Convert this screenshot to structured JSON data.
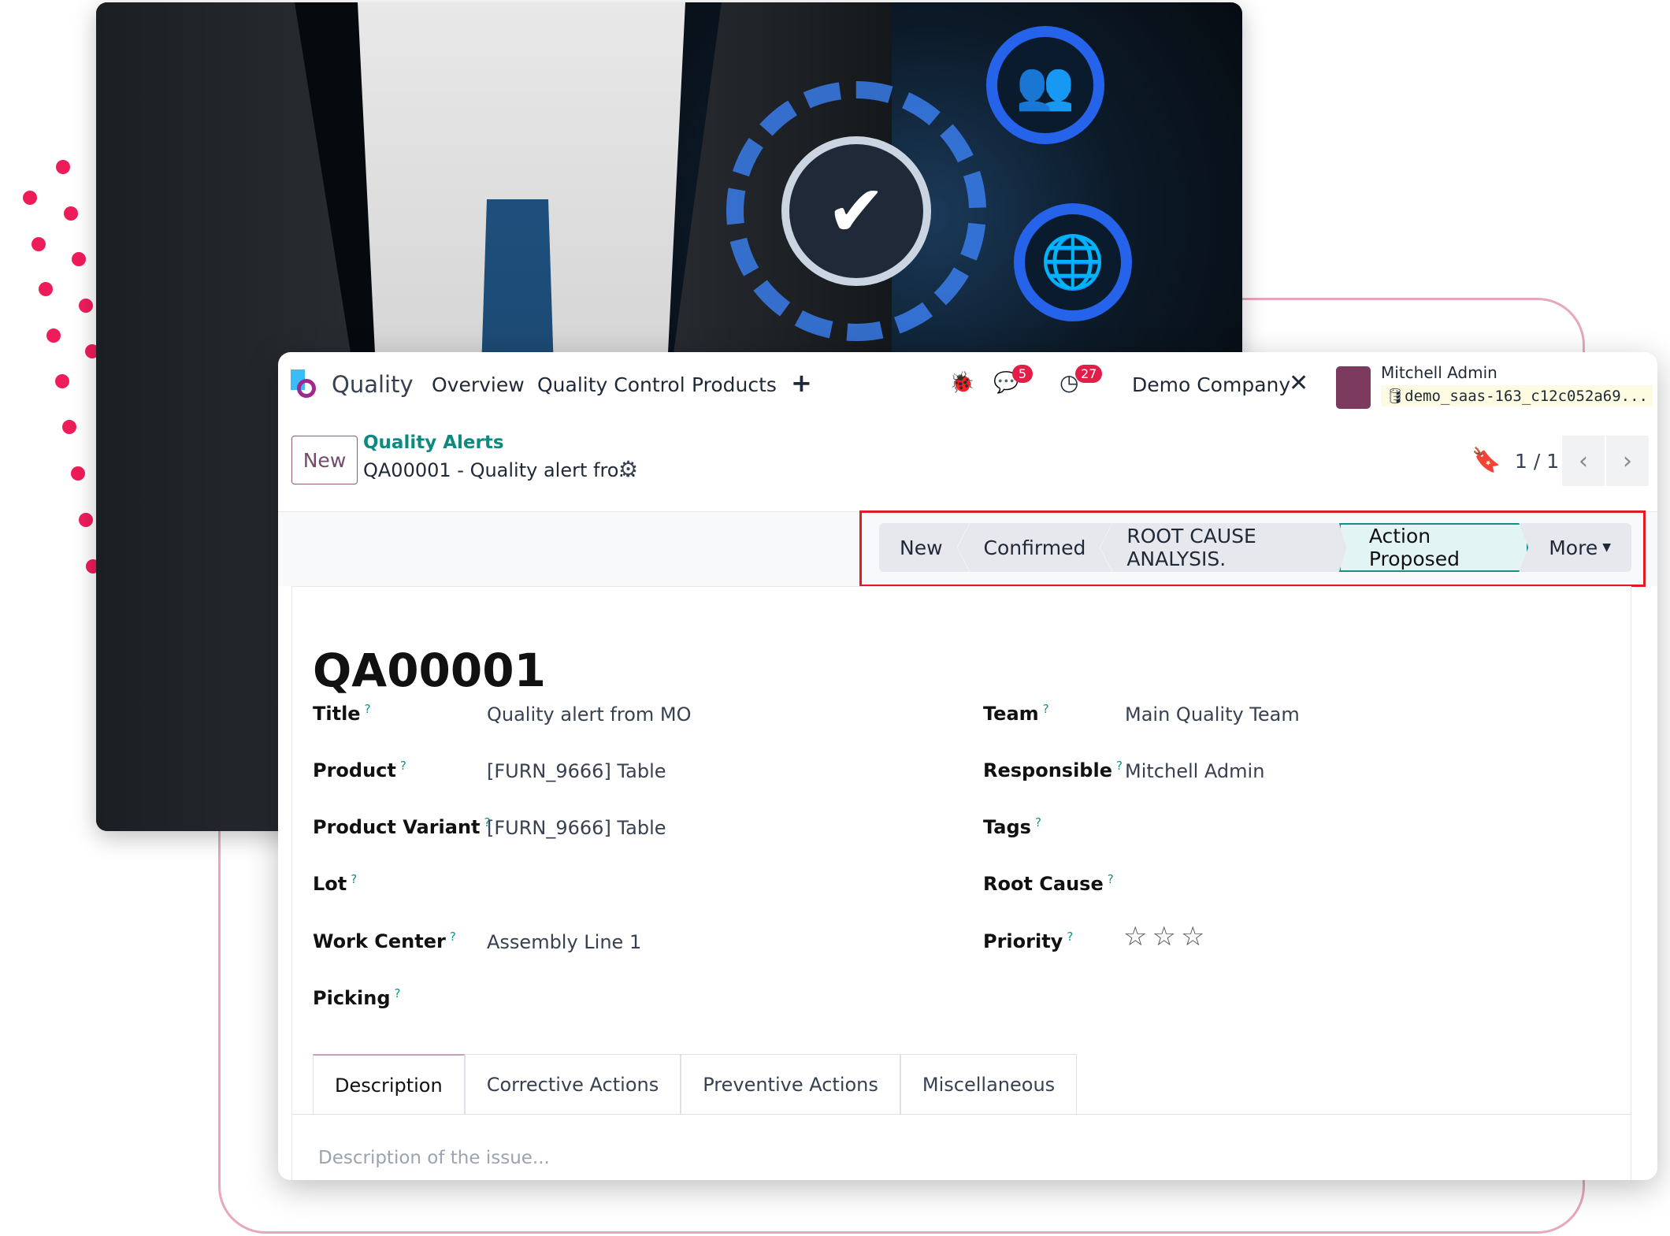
{
  "navbar": {
    "app_name": "Quality",
    "menus": [
      "Overview",
      "Quality Control",
      "Products"
    ],
    "plus": "+",
    "messages_badge": "5",
    "activities_badge": "27",
    "company": "Demo Company",
    "user_name": "Mitchell Admin",
    "database": "demo_saas-163_c12c052a69..."
  },
  "control": {
    "new_button": "New",
    "breadcrumb_parent": "Quality Alerts",
    "breadcrumb_current": "QA00001 - Quality alert fro...",
    "pager": "1 / 1"
  },
  "statusbar": {
    "stages": [
      "New",
      "Confirmed",
      "ROOT CAUSE ANALYSIS.",
      "Action Proposed"
    ],
    "active_stage": "Action Proposed",
    "more": "More"
  },
  "form": {
    "reference": "QA00001",
    "left_fields": [
      {
        "label": "Title",
        "value": "Quality alert from MO"
      },
      {
        "label": "Product",
        "value": "[FURN_9666] Table"
      },
      {
        "label": "Product Variant",
        "value": "[FURN_9666] Table"
      },
      {
        "label": "Lot",
        "value": ""
      },
      {
        "label": "Work Center",
        "value": "Assembly Line 1"
      },
      {
        "label": "Picking",
        "value": ""
      }
    ],
    "right_fields": [
      {
        "label": "Team",
        "value": "Main Quality Team"
      },
      {
        "label": "Responsible",
        "value": "Mitchell Admin"
      },
      {
        "label": "Tags",
        "value": ""
      },
      {
        "label": "Root Cause",
        "value": ""
      },
      {
        "label": "Priority",
        "value": ""
      }
    ],
    "priority_stars": 0,
    "priority_max": 3,
    "help_mark": "?",
    "tabs": [
      "Description",
      "Corrective Actions",
      "Preventive Actions",
      "Miscellaneous"
    ],
    "active_tab": "Description",
    "description_placeholder": "Description of the issue..."
  },
  "colors": {
    "brand": "#714b67",
    "teal": "#0d9488",
    "highlight": "#e11d22",
    "badge": "#e11d48"
  }
}
